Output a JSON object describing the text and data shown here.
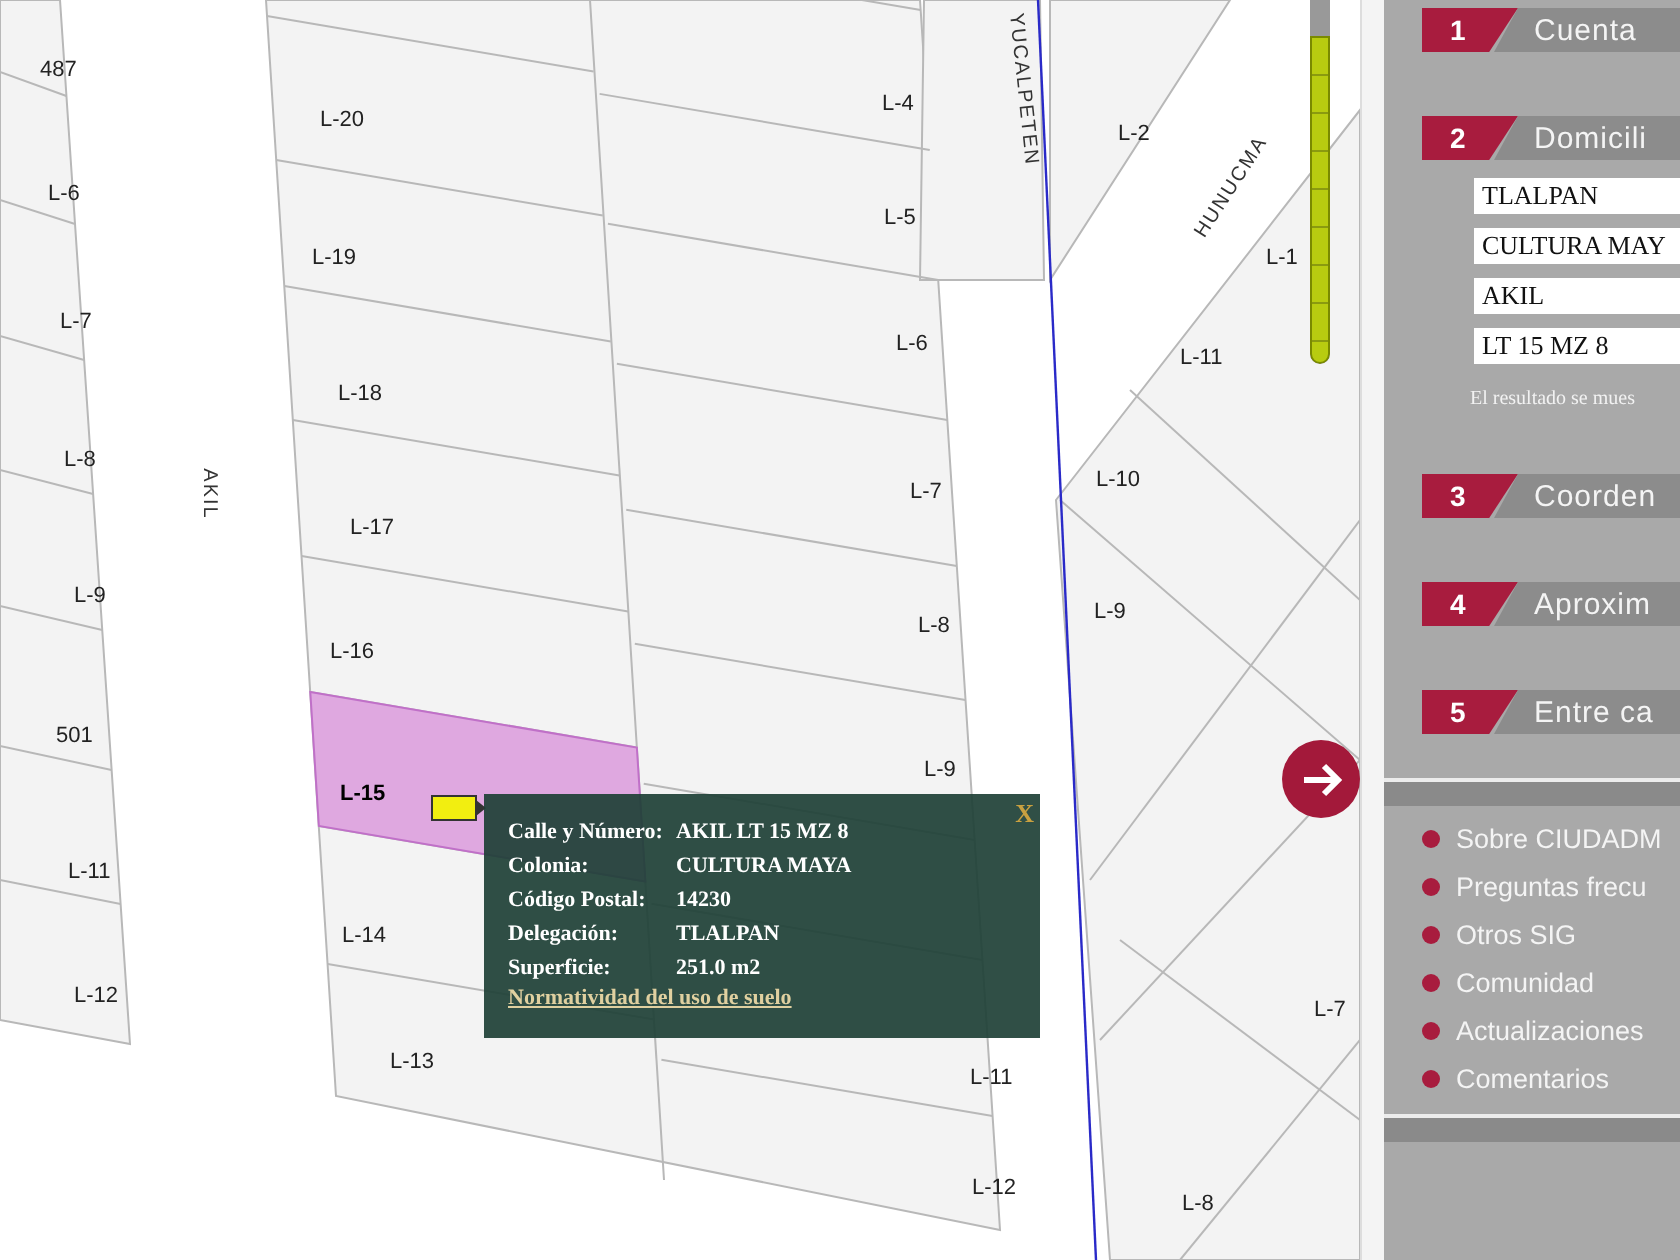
{
  "map": {
    "lot_labels": [
      {
        "text": "487",
        "selected": false
      },
      {
        "text": "L-6",
        "selected": false
      },
      {
        "text": "L-7",
        "selected": false
      },
      {
        "text": "L-8",
        "selected": false
      },
      {
        "text": "L-9",
        "selected": false
      },
      {
        "text": "501",
        "selected": false
      },
      {
        "text": "L-11",
        "selected": false
      },
      {
        "text": "L-12",
        "selected": false
      },
      {
        "text": "L-20",
        "selected": false
      },
      {
        "text": "L-19",
        "selected": false
      },
      {
        "text": "L-18",
        "selected": false
      },
      {
        "text": "L-17",
        "selected": false
      },
      {
        "text": "L-16",
        "selected": false
      },
      {
        "text": "L-15",
        "selected": true
      },
      {
        "text": "L-14",
        "selected": false
      },
      {
        "text": "L-13",
        "selected": false
      },
      {
        "text": "L-4",
        "selected": false
      },
      {
        "text": "L-5",
        "selected": false
      },
      {
        "text": "L-6",
        "selected": false
      },
      {
        "text": "L-7",
        "selected": false
      },
      {
        "text": "L-8",
        "selected": false
      },
      {
        "text": "L-9",
        "selected": false
      },
      {
        "text": "L-11",
        "selected": false
      },
      {
        "text": "L-12",
        "selected": false
      },
      {
        "text": "L-2",
        "selected": false
      },
      {
        "text": "L-1",
        "selected": false
      },
      {
        "text": "L-11",
        "selected": false
      },
      {
        "text": "L-10",
        "selected": false
      },
      {
        "text": "L-9",
        "selected": false
      },
      {
        "text": "L-7",
        "selected": false
      },
      {
        "text": "L-8",
        "selected": false
      }
    ],
    "street_labels": [
      "AKIL",
      "YUCALPETEN",
      "HUNUCMA"
    ],
    "zoom_slider": {
      "level": 0.9
    },
    "popup": {
      "close": "X",
      "rows": [
        {
          "label": "Calle y Número:",
          "value": "AKIL LT 15 MZ 8"
        },
        {
          "label": "Colonia:",
          "value": "CULTURA MAYA"
        },
        {
          "label": "Código Postal:",
          "value": "14230"
        },
        {
          "label": "Delegación:",
          "value": "TLALPAN"
        },
        {
          "label": "Superficie:",
          "value": "251.0 m2"
        }
      ],
      "link": "Normatividad del uso de suelo"
    }
  },
  "panel": {
    "steps": [
      {
        "number": "1",
        "title": "Cuenta"
      },
      {
        "number": "2",
        "title": "Domicili",
        "fields": [
          "TLALPAN",
          "CULTURA MAY",
          "AKIL",
          "LT 15 MZ 8"
        ],
        "note": "El resultado se mues"
      },
      {
        "number": "3",
        "title": "Coorden"
      },
      {
        "number": "4",
        "title": "Aproxim"
      },
      {
        "number": "5",
        "title": "Entre ca"
      }
    ],
    "menu": [
      "Sobre CIUDADM",
      "Preguntas frecu",
      "Otros SIG",
      "Comunidad",
      "Actualizaciones",
      "Comentarios"
    ]
  }
}
